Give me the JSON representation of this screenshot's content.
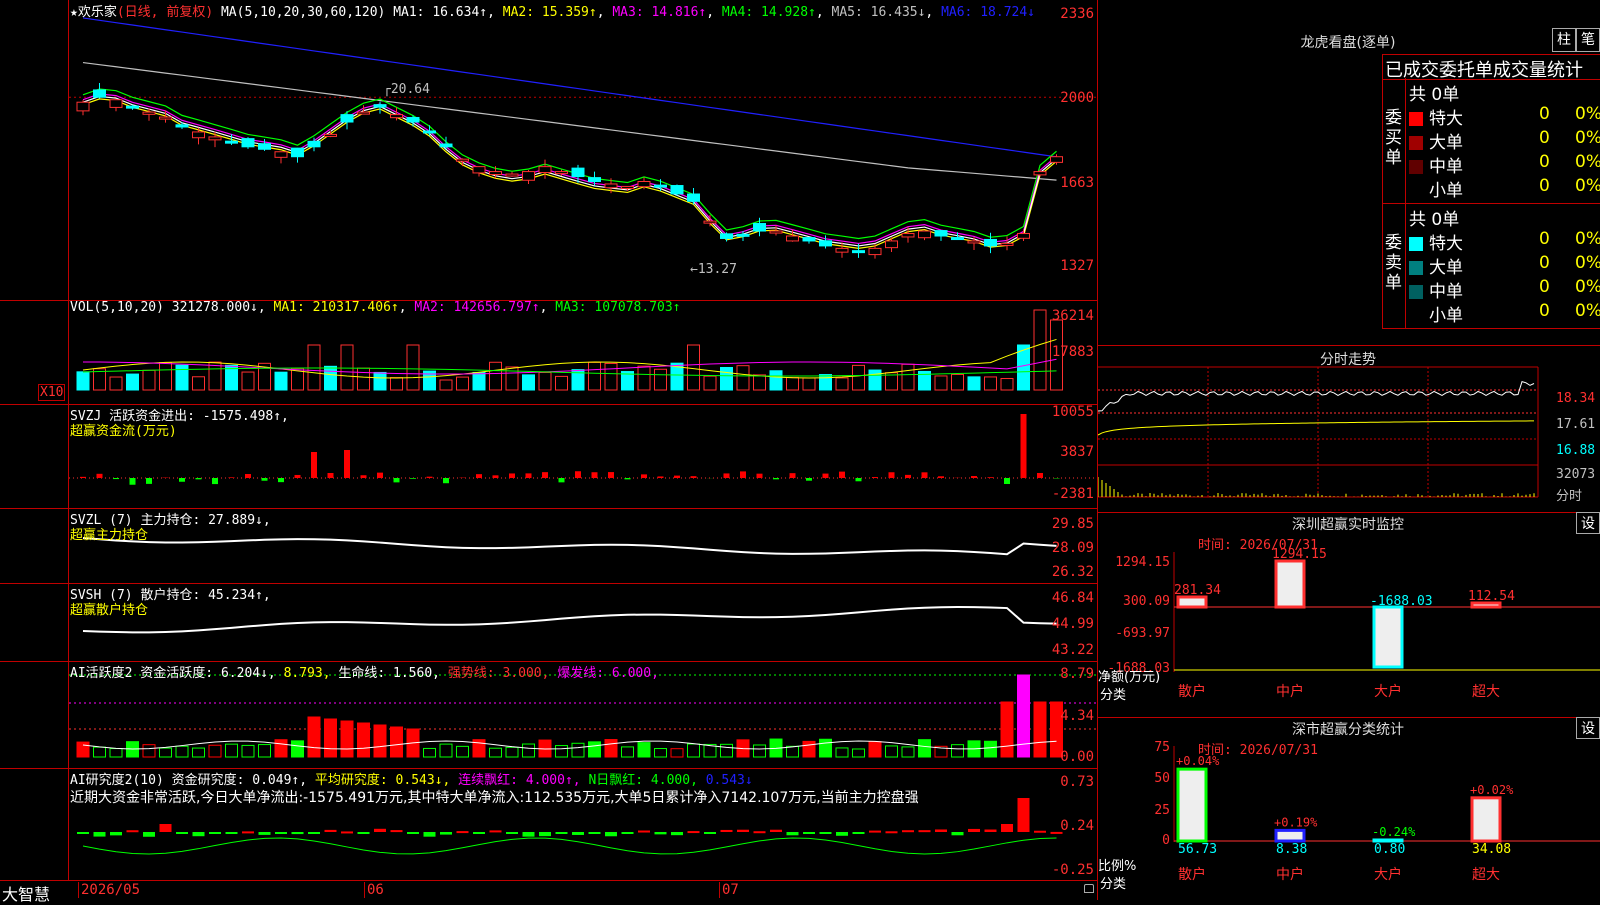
{
  "stock": {
    "star": "★",
    "name": "欢乐家",
    "mode": "(日线, 前复权)"
  },
  "main": {
    "ticks": [
      "2336",
      "2000",
      "1663",
      "1327"
    ],
    "ma_label": "MA(5,10,20,30,60,120)",
    "ma": [
      {
        "t": "MA1: 16.634↑",
        "c": "#ffffff"
      },
      {
        "t": "MA2: 15.359↑",
        "c": "#ffff00"
      },
      {
        "t": "MA3: 14.816↑",
        "c": "#ff00ff"
      },
      {
        "t": "MA4: 14.928↑",
        "c": "#00ff00"
      },
      {
        "t": "MA5: 16.435↓",
        "c": "#c0c0c0"
      },
      {
        "t": "MA6: 18.724↓",
        "c": "#2020ff"
      }
    ],
    "hi": "20.64",
    "lo": "13.27"
  },
  "vol": {
    "ticks": [
      "36214",
      "17883"
    ],
    "unit": "X10",
    "label": "VOL(5,10,20)",
    "val": "321278.000↓",
    "ma": [
      {
        "t": "MA1: 210317.406↑",
        "c": "#ffff00"
      },
      {
        "t": "MA2: 142656.797↑",
        "c": "#ff00ff"
      },
      {
        "t": "MA3: 107078.703↑",
        "c": "#00ff00"
      }
    ]
  },
  "svzj": {
    "ticks": [
      "10055",
      "3837",
      "-2381"
    ],
    "l1": "SVZJ  活跃资金进出: -1575.498↑,",
    "l2": "超赢资金流(万元)"
  },
  "svzl": {
    "ticks": [
      "29.85",
      "28.09",
      "26.32"
    ],
    "l1": "SVZL (7) 主力持仓: 27.889↓,",
    "l2": "超赢主力持仓"
  },
  "svsh": {
    "ticks": [
      "46.84",
      "44.99",
      "43.22"
    ],
    "l1": "SVSH (7) 散户持仓: 45.234↑,",
    "l2": "超赢散户持仓"
  },
  "ai1": {
    "ticks": [
      "8.79",
      "4.34",
      "0.00"
    ],
    "parts": [
      {
        "t": "AI活跃度2 资金活跃度: 6.204↓,",
        "c": "#ffffff"
      },
      {
        "t": "8.793,",
        "c": "#ffff00"
      },
      {
        "t": "生命线: 1.560,",
        "c": "#ffffff"
      },
      {
        "t": "强势线: 3.000,",
        "c": "#ff3030"
      },
      {
        "t": "爆发线: 6.000,",
        "c": "#ff00ff"
      }
    ]
  },
  "ai2": {
    "ticks": [
      "0.73",
      "0.24",
      "-0.25"
    ],
    "parts": [
      {
        "t": "AI研究度2(10) 资金研究度: 0.049↑,",
        "c": "#ffffff"
      },
      {
        "t": "平均研究度: 0.543↓,",
        "c": "#ffff00"
      },
      {
        "t": "连续飘红: 4.000↑,",
        "c": "#ff00ff"
      },
      {
        "t": "N日飘红: 4.000,",
        "c": "#00ff00"
      },
      {
        "t": "0.543↓",
        "c": "#2020ff"
      }
    ],
    "comment": "近期大资金非常活跃,今日大单净流出:-1575.491万元,其中特大单净流入:112.535万元,大单5日累计净入7142.107万元,当前主力控盘强"
  },
  "bottom": {
    "brand": "大智慧",
    "dates": [
      "2026/05",
      "06",
      "07"
    ]
  },
  "lhb": {
    "title": "龙虎看盘(逐单)",
    "btn1": "柱",
    "btn2": "笔",
    "tab": "已成交委托单成交量统计",
    "buy": {
      "label": "委买单",
      "total": "共 0单",
      "rows": [
        {
          "name": "特大",
          "v": "0",
          "p": "0%",
          "c": "#ff0000"
        },
        {
          "name": "大单",
          "v": "0",
          "p": "0%",
          "c": "#a00000"
        },
        {
          "name": "中单",
          "v": "0",
          "p": "0%",
          "c": "#600000"
        },
        {
          "name": "小单",
          "v": "0",
          "p": "0%",
          "c": "#000000"
        }
      ]
    },
    "sell": {
      "label": "委卖单",
      "total": "共 0单",
      "rows": [
        {
          "name": "特大",
          "v": "0",
          "p": "0%",
          "c": "#00ffff"
        },
        {
          "name": "大单",
          "v": "0",
          "p": "0%",
          "c": "#008080"
        },
        {
          "name": "中单",
          "v": "0",
          "p": "0%",
          "c": "#006060"
        },
        {
          "name": "小单",
          "v": "0",
          "p": "0%",
          "c": "#000000"
        }
      ]
    }
  },
  "fs": {
    "title": "分时走势",
    "ticks": [
      "18.34",
      "17.61",
      "16.88",
      "32073",
      "分时"
    ]
  },
  "szmon": {
    "title": "深圳超赢实时监控",
    "btn": "设",
    "time": "时间: 2026/07/31",
    "ticks": [
      "1294.15",
      "300.09",
      "-693.97",
      "-1688.03"
    ],
    "ylabel": "净额(万元)",
    "xlabel": "分类",
    "cats": [
      "散户",
      "中户",
      "大户",
      "超大"
    ],
    "vals": [
      {
        "t": "281.34",
        "v": 281.34
      },
      {
        "t": "1294.15",
        "v": 1294.15
      },
      {
        "t": "-1688.03",
        "v": -1688.03
      },
      {
        "t": "112.54",
        "v": 112.54
      }
    ]
  },
  "szcls": {
    "title": "深市超赢分类统计",
    "btn": "设",
    "time": "时间: 2026/07/31",
    "ticks": [
      "75",
      "50",
      "25",
      "0"
    ],
    "ylabel": "比例%",
    "xlabel": "分类",
    "cats": [
      "散户",
      "中户",
      "大户",
      "超大"
    ],
    "tops": [
      "+0.04%",
      "+0.19%",
      "-0.24%",
      "+0.02%"
    ],
    "vals": [
      {
        "t": "56.73",
        "v": 56.73
      },
      {
        "t": "8.38",
        "v": 8.38
      },
      {
        "t": "0.80",
        "v": 0.8
      },
      {
        "t": "34.08",
        "v": 34.08
      }
    ]
  }
}
